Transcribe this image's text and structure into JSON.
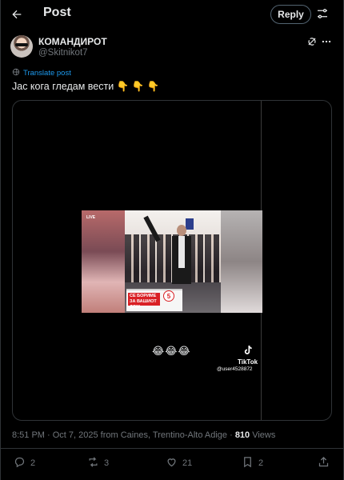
{
  "header": {
    "title": "Post",
    "reply_label": "Reply"
  },
  "author": {
    "display_name": "КОМАНДИРОТ",
    "handle": "@Skitnikot7"
  },
  "post": {
    "translate_label": "Translate post",
    "text": "Јас кога гледам вести 👇 👇 👇",
    "media": {
      "overlay_emojis": "😂😂😂",
      "podium_sign": "СЕ БОРИМЕ ЗА ВАШИОТ ДОМ",
      "podium_number": "5",
      "live_label": "LIVE",
      "watermark_brand": "TikTok",
      "watermark_user": "@user4528872"
    },
    "timestamp": "8:51 PM · Oct 7, 2025 from Caines, Trentino-Alto Adige · ",
    "views_count": "810",
    "views_label": " Views"
  },
  "actions": {
    "replies": "2",
    "reposts": "3",
    "likes": "21",
    "bookmarks": "2"
  },
  "colors": {
    "background": "#000000",
    "text": "#e7e9ea",
    "muted": "#71767b",
    "accent": "#1d9bf0",
    "border": "#2f3336"
  },
  "icons": [
    "back-arrow-icon",
    "settings-icon",
    "grok-icon",
    "more-icon",
    "translate-icon",
    "reply-icon",
    "repost-icon",
    "like-icon",
    "bookmark-icon",
    "share-icon",
    "tiktok-icon"
  ]
}
